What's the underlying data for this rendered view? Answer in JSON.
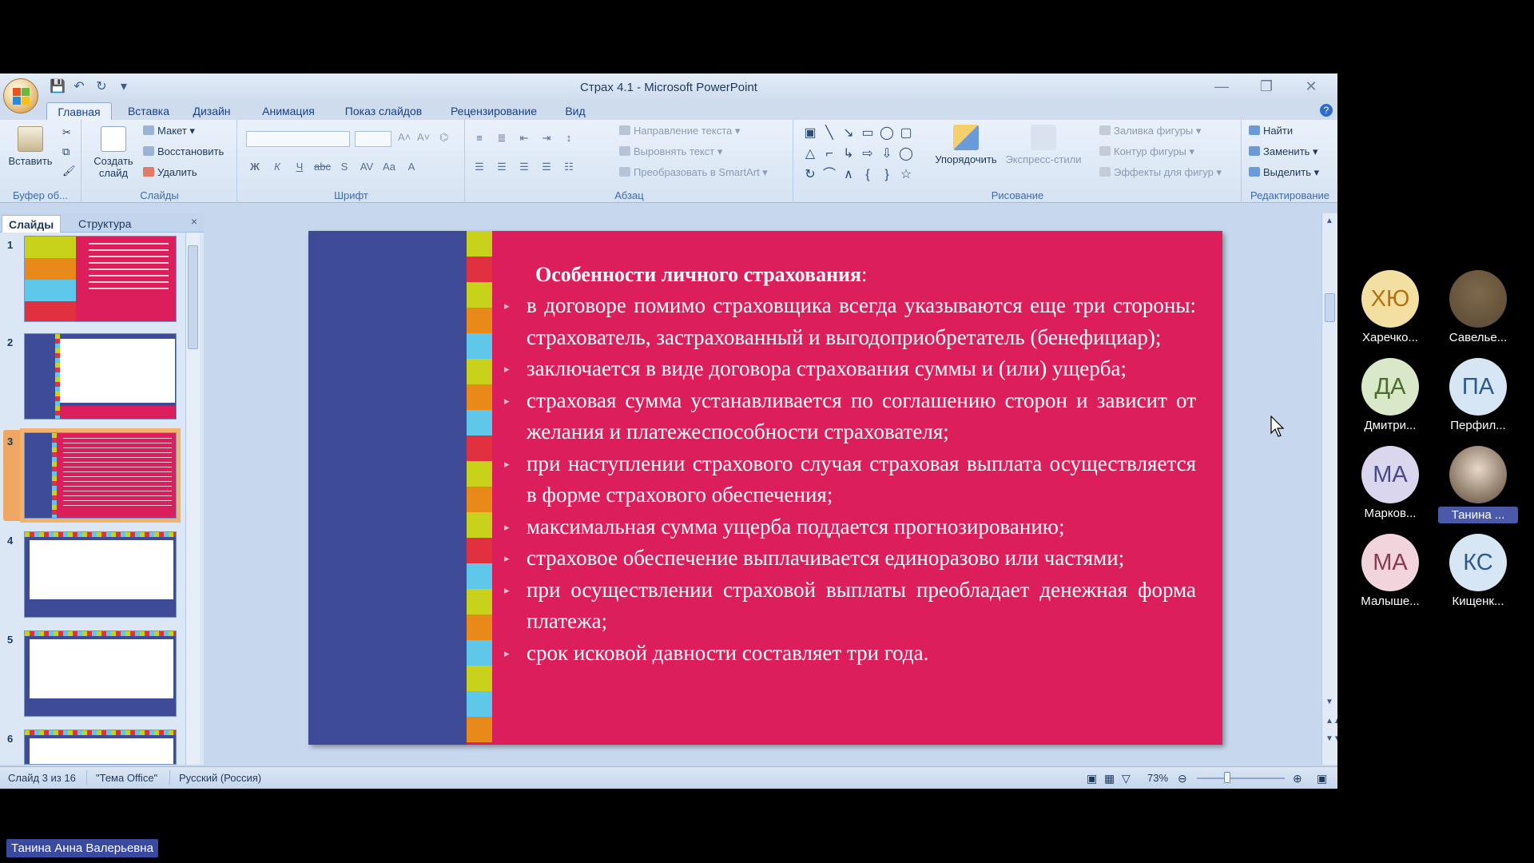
{
  "window": {
    "title": "Страх 4.1 - Microsoft PowerPoint"
  },
  "ribbon_tabs": [
    "Главная",
    "Вставка",
    "Дизайн",
    "Анимация",
    "Показ слайдов",
    "Рецензирование",
    "Вид"
  ],
  "ribbon": {
    "clipboard": {
      "paste": "Вставить",
      "label": "Буфер об..."
    },
    "slides": {
      "create_line1": "Создать",
      "create_line2": "слайд",
      "layout": "Макет",
      "reset": "Восстановить",
      "delete": "Удалить",
      "label": "Слайды"
    },
    "font": {
      "label": "Шрифт"
    },
    "paragraph": {
      "text_direction": "Направление текста",
      "align_text": "Выровнять текст",
      "convert_smartart": "Преобразовать в SmartArt",
      "label": "Абзац"
    },
    "drawing": {
      "arrange": "Упорядочить",
      "quick_styles": "Экспресс-стили",
      "shape_fill": "Заливка фигуры",
      "shape_outline": "Контур фигуры",
      "shape_effects": "Эффекты для фигур",
      "label": "Рисование"
    },
    "editing": {
      "find": "Найти",
      "replace": "Заменить",
      "select": "Выделить",
      "label": "Редактирование"
    }
  },
  "left_pane": {
    "tab_slides": "Слайды",
    "tab_outline": "Структура",
    "close": "×",
    "thumbnails": [
      {
        "num": "1"
      },
      {
        "num": "2"
      },
      {
        "num": "3"
      },
      {
        "num": "4"
      },
      {
        "num": "5"
      },
      {
        "num": "6"
      }
    ],
    "selected": "3"
  },
  "slide": {
    "title_bold": "Особенности личного страхования",
    "title_suffix": ":",
    "bullets": [
      "в договоре помимо страховщика всегда указываются еще три стороны: страхователь, застрахованный и выгодоприобретатель (бенефициар);",
      "заключается в виде договора страхования суммы и (или) ущерба;",
      "страховая сумма устанавливается по соглашению сторон и зависит от желания и платежеспособности страхователя;",
      "при наступлении страхового случая страховая выплата осуществляется в форме страхового обеспечения;",
      "максимальная сумма ущерба поддается прогнозированию;",
      "страховое обеспечение выплачивается единоразово или частями;",
      "при осуществлении страховой выплаты преобладает денежная форма платежа;",
      "срок исковой давности составляет три года."
    ],
    "strip_colors": [
      "#c8d21a",
      "#e1303e",
      "#c8d21a",
      "#e8891a",
      "#5fc8ea",
      "#c8d21a",
      "#e8891a",
      "#5fc8ea",
      "#e1303e",
      "#c8d21a",
      "#e8891a",
      "#c8d21a",
      "#e1303e",
      "#5fc8ea",
      "#c8d21a",
      "#e8891a",
      "#5fc8ea",
      "#c8d21a",
      "#5fc8ea",
      "#e8891a"
    ]
  },
  "status": {
    "slide_of": "Слайд 3 из 16",
    "theme": "\"Тема Office\"",
    "language": "Русский (Россия)",
    "zoom": "73%"
  },
  "participants": [
    {
      "initials": "ХЮ",
      "name": "Харечко...",
      "bg": "#f4dfa2",
      "fg": "#b2730f"
    },
    {
      "initials": "",
      "name": "Савелье...",
      "bg": "#7d6a4c",
      "fg": "#fff",
      "photo": true
    },
    {
      "initials": "ДА",
      "name": "Дмитри...",
      "bg": "#d9e8c9",
      "fg": "#4c6c2c"
    },
    {
      "initials": "ПА",
      "name": "Перфил...",
      "bg": "#d6e6f4",
      "fg": "#2d5a8a"
    },
    {
      "initials": "МА",
      "name": "Марков...",
      "bg": "#d9d6ee",
      "fg": "#4a4a8a"
    },
    {
      "initials": "",
      "name": "Танина ...",
      "bg": "#e9d9c9",
      "fg": "#fff",
      "photo": true,
      "highlight": true
    },
    {
      "initials": "МА",
      "name": "Малыше...",
      "bg": "#f1d4dc",
      "fg": "#8a3a55"
    },
    {
      "initials": "КС",
      "name": "Кищенк...",
      "bg": "#d6e6f4",
      "fg": "#2d5a8a"
    }
  ],
  "speaker": "Танина Анна Валерьевна"
}
